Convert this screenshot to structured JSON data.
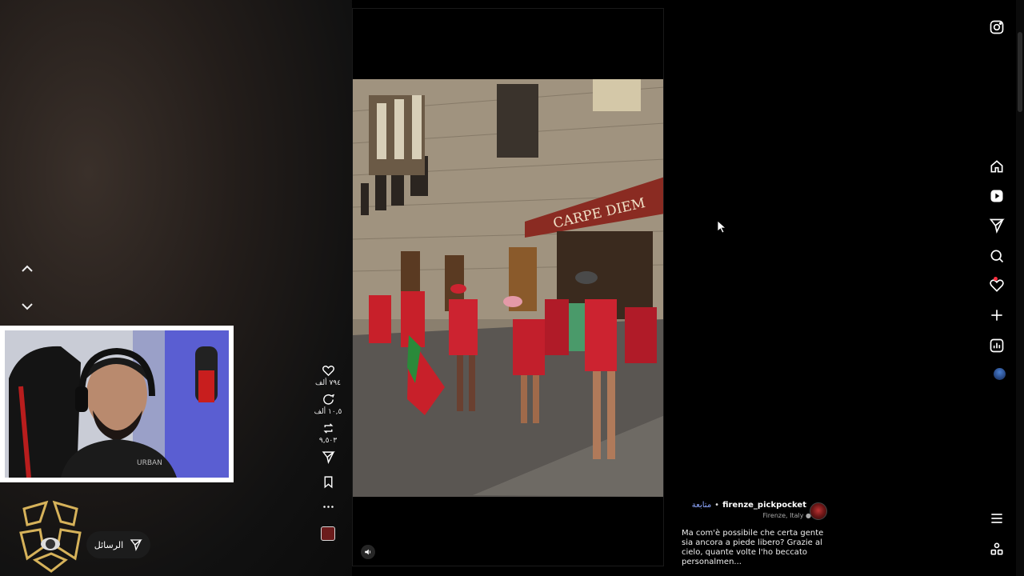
{
  "navigation": {
    "prev_icon": "chevron-up-icon",
    "next_icon": "chevron-down-icon"
  },
  "messages_button": {
    "label": "الرسائل",
    "icon": "send-icon"
  },
  "reel": {
    "storefront_sign": "CARPE DIEM",
    "actions": {
      "likes": "٧٩٤ ألف",
      "comments": "١٠,٥ ألف",
      "reposts": "٩,٥٠٣"
    },
    "author": {
      "username": "firenze_pickpocket",
      "follow_label": "متابعة",
      "separator": "•",
      "location": "Firenze, Italy"
    },
    "caption": "Ma com'è possibile che certa gente sia ancora a piede libero? Grazie al cielo, quante volte l'ho beccato personalmen..."
  },
  "sidebar": {
    "items": [
      "instagram-logo",
      "home",
      "reels",
      "messages",
      "search",
      "notifications",
      "create",
      "dashboard",
      "profile",
      "more",
      "also-from-meta"
    ]
  },
  "colors": {
    "accent_link": "#8fa8ff",
    "notification_dot": "#ff3040",
    "background": "#000000"
  }
}
